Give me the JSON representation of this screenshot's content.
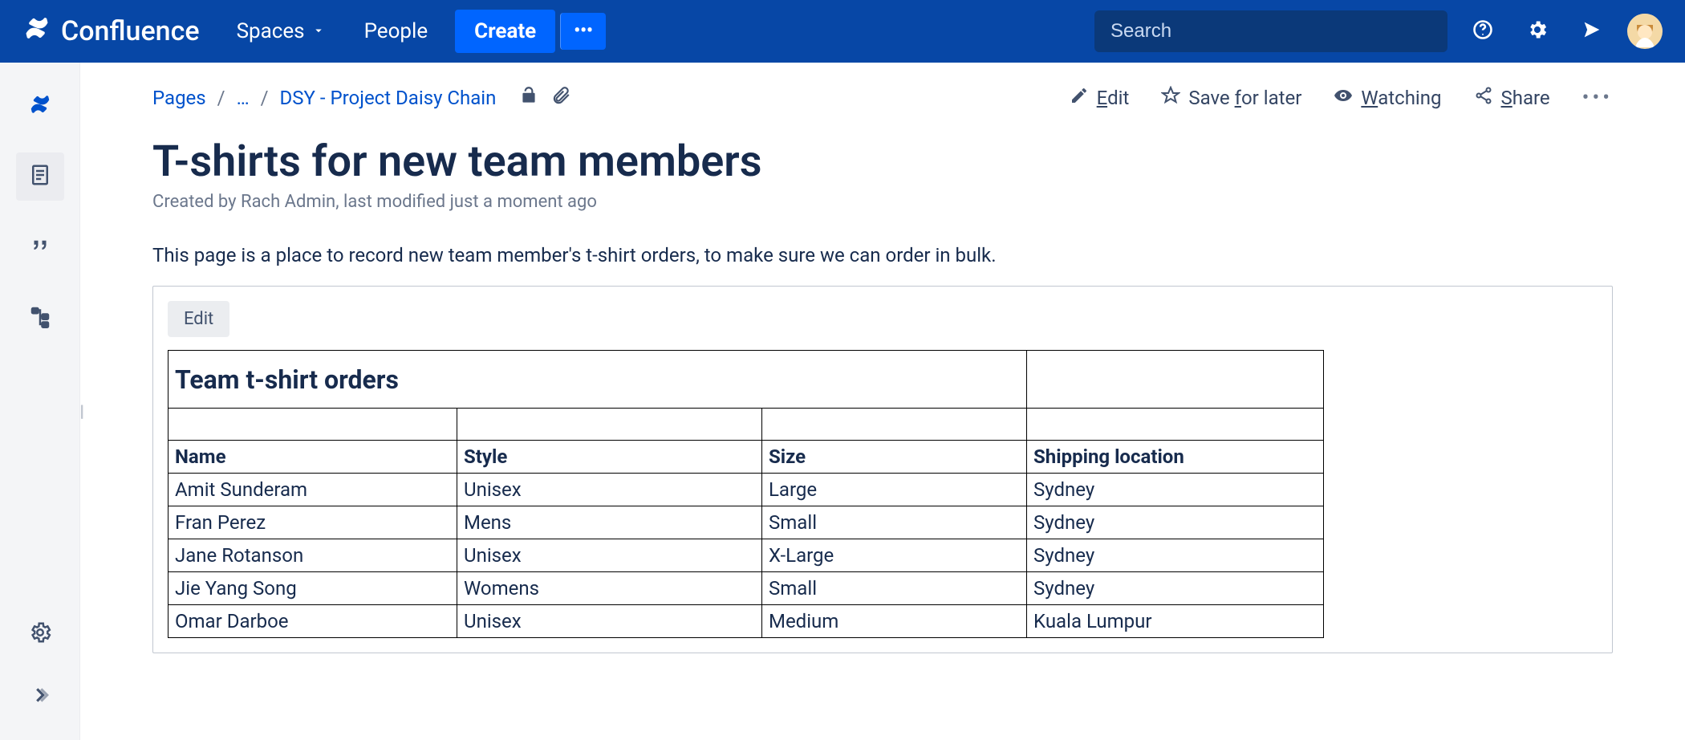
{
  "topnav": {
    "brand": "Confluence",
    "spaces": "Spaces",
    "people": "People",
    "create": "Create",
    "search_placeholder": "Search"
  },
  "breadcrumbs": {
    "pages": "Pages",
    "ellipsis": "…",
    "current_space": "DSY - Project Daisy Chain"
  },
  "page_actions": {
    "edit_prefix": "E",
    "edit_rest": "dit",
    "save": "Save ",
    "save_u": "f",
    "save_rest": "or later",
    "watching_u": "W",
    "watching_rest": "atching",
    "share_u": "S",
    "share_rest": "hare"
  },
  "page": {
    "title": "T-shirts for new team members",
    "meta": "Created by Rach Admin, last modified just a moment ago",
    "intro": "This page is a place to record new team member's t-shirt orders, to make sure we can order in bulk."
  },
  "panel": {
    "edit": "Edit",
    "sheet_title": "Team t-shirt orders",
    "columns": [
      "Name",
      "Style",
      "Size",
      "Shipping location"
    ],
    "rows": [
      [
        "Amit Sunderam",
        "Unisex",
        "Large",
        "Sydney"
      ],
      [
        "Fran Perez",
        "Mens",
        "Small",
        "Sydney"
      ],
      [
        "Jane Rotanson",
        "Unisex",
        "X-Large",
        "Sydney"
      ],
      [
        "Jie Yang Song",
        "Womens",
        "Small",
        "Sydney"
      ],
      [
        "Omar Darboe",
        "Unisex",
        "Medium",
        "Kuala Lumpur"
      ]
    ]
  }
}
